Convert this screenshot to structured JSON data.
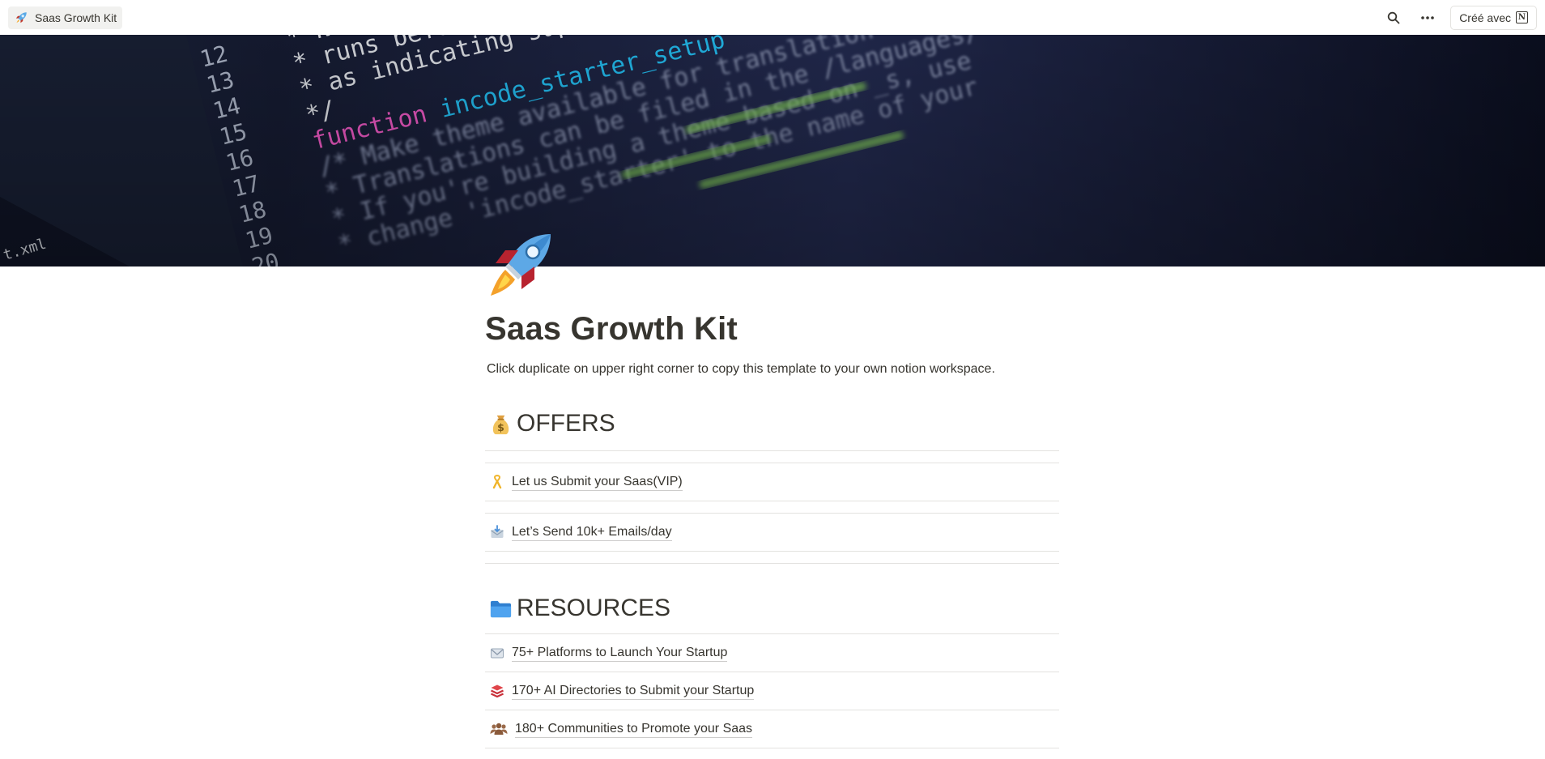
{
  "topbar": {
    "page_name": "Saas Growth Kit",
    "made_with_label": "Créé avec"
  },
  "page": {
    "title": "Saas Growth Kit",
    "subtitle": "Click duplicate on upper right corner to copy this template to your own notion workspace."
  },
  "offers": {
    "heading": "OFFERS",
    "icon": "money-bag-icon",
    "items": [
      {
        "label": "Let us Submit your Saas(VIP)",
        "icon": "ribbon-icon"
      },
      {
        "label": "Let’s Send 10k+ Emails/day",
        "icon": "envelope-tray-icon"
      }
    ]
  },
  "resources": {
    "heading": "RESOURCES",
    "icon": "folder-icon",
    "items": [
      {
        "label": "75+ Platforms to Launch Your Startup",
        "icon": "envelope-icon"
      },
      {
        "label": "170+ AI Directories to Submit your Startup",
        "icon": "stack-icon"
      },
      {
        "label": "180+ Communities to Promote your Saas",
        "icon": "people-icon"
      }
    ]
  },
  "cover": {
    "code_lines": [
      {
        "num": "12",
        "text": "* Note that"
      },
      {
        "num": "13",
        "text": "* runs before indicating support"
      },
      {
        "num": "14",
        "text": "* as indicating support"
      },
      {
        "num": "15",
        "text": "*/"
      },
      {
        "num": "16",
        "text": "function incode_starter_setup"
      },
      {
        "num": "17",
        "text": "/* Make theme available for translation"
      },
      {
        "num": "18",
        "text": "* Translations can be filed in the /languages/"
      },
      {
        "num": "19",
        "text": "* If you're building a theme based on _s, use"
      },
      {
        "num": "20",
        "text": "* change 'incode_starter' to the name of your"
      }
    ],
    "file_label": "t.xml",
    "colors": {
      "background": "#141a33",
      "keyword": "#ff5fd2",
      "function_name": "#25c9ff",
      "string": "#8fe060"
    }
  },
  "colors": {
    "text": "#37352f",
    "divider": "#e3e2df"
  }
}
